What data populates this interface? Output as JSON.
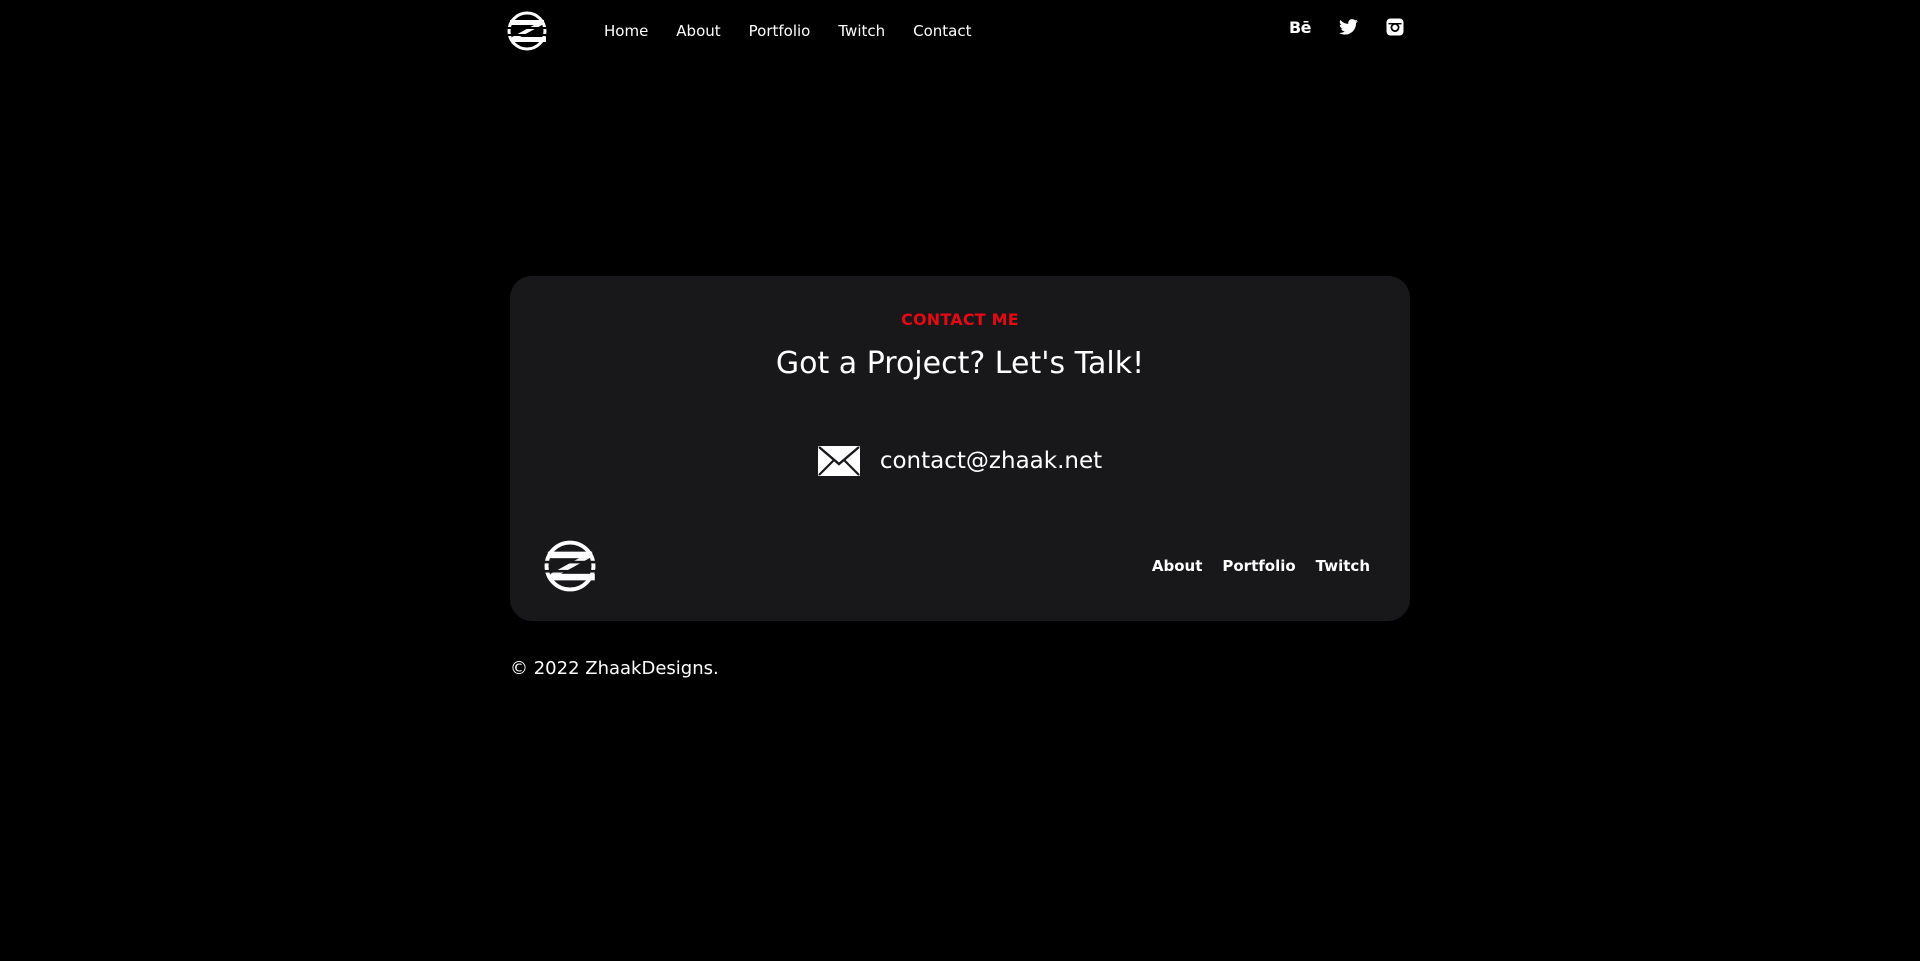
{
  "header": {
    "logo_alt": "ZhaakDesigns logo",
    "nav": [
      {
        "label": "Home"
      },
      {
        "label": "About"
      },
      {
        "label": "Portfolio"
      },
      {
        "label": "Twitch"
      },
      {
        "label": "Contact"
      }
    ],
    "social": {
      "behance_label": "Bē",
      "twitter_icon": "twitter-icon",
      "instagram_icon": "instagram-icon"
    }
  },
  "contact": {
    "eyebrow": "CONTACT ME",
    "headline": "Got a Project? Let's Talk!",
    "email": "contact@zhaak.net",
    "email_icon": "mail-icon"
  },
  "footer": {
    "nav": [
      {
        "label": "About"
      },
      {
        "label": "Portfolio"
      },
      {
        "label": "Twitch"
      }
    ]
  },
  "copyright": "© 2022 ZhaakDesigns.",
  "colors": {
    "background": "#000000",
    "card": "#18181b",
    "accent": "#e50914",
    "text": "#ffffff"
  }
}
